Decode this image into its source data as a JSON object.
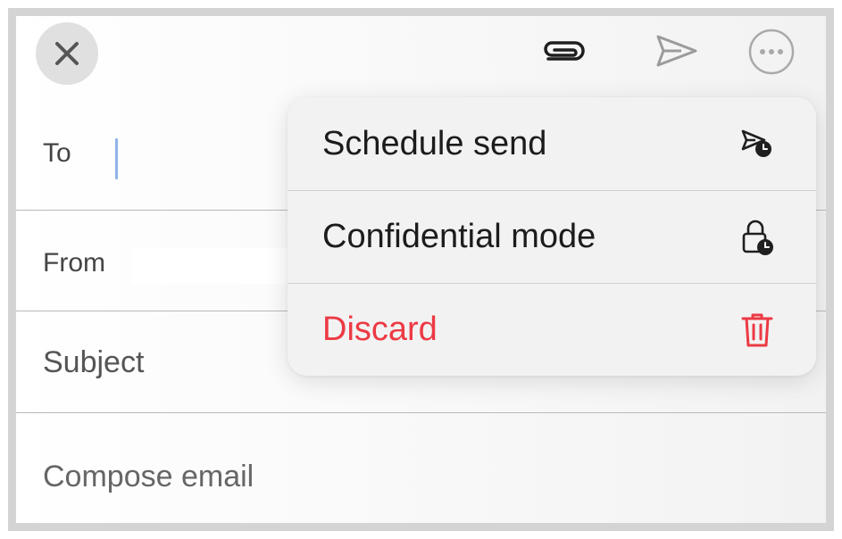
{
  "toolbar": {
    "close_icon": "close-icon",
    "attach_icon": "paperclip-icon",
    "send_icon": "send-icon",
    "more_icon": "more-icon"
  },
  "fields": {
    "to_label": "To",
    "from_label": "From",
    "subject_placeholder": "Subject",
    "body_placeholder": "Compose email"
  },
  "menu": {
    "items": [
      {
        "label": "Schedule send",
        "icon": "schedule-send-icon"
      },
      {
        "label": "Confidential mode",
        "icon": "lock-clock-icon"
      },
      {
        "label": "Discard",
        "icon": "trash-icon"
      }
    ]
  },
  "colors": {
    "danger": "#ec3a44",
    "caret": "#8fb3e9",
    "icon_dark": "#1f1f1f",
    "icon_muted": "#9b9b9b"
  }
}
